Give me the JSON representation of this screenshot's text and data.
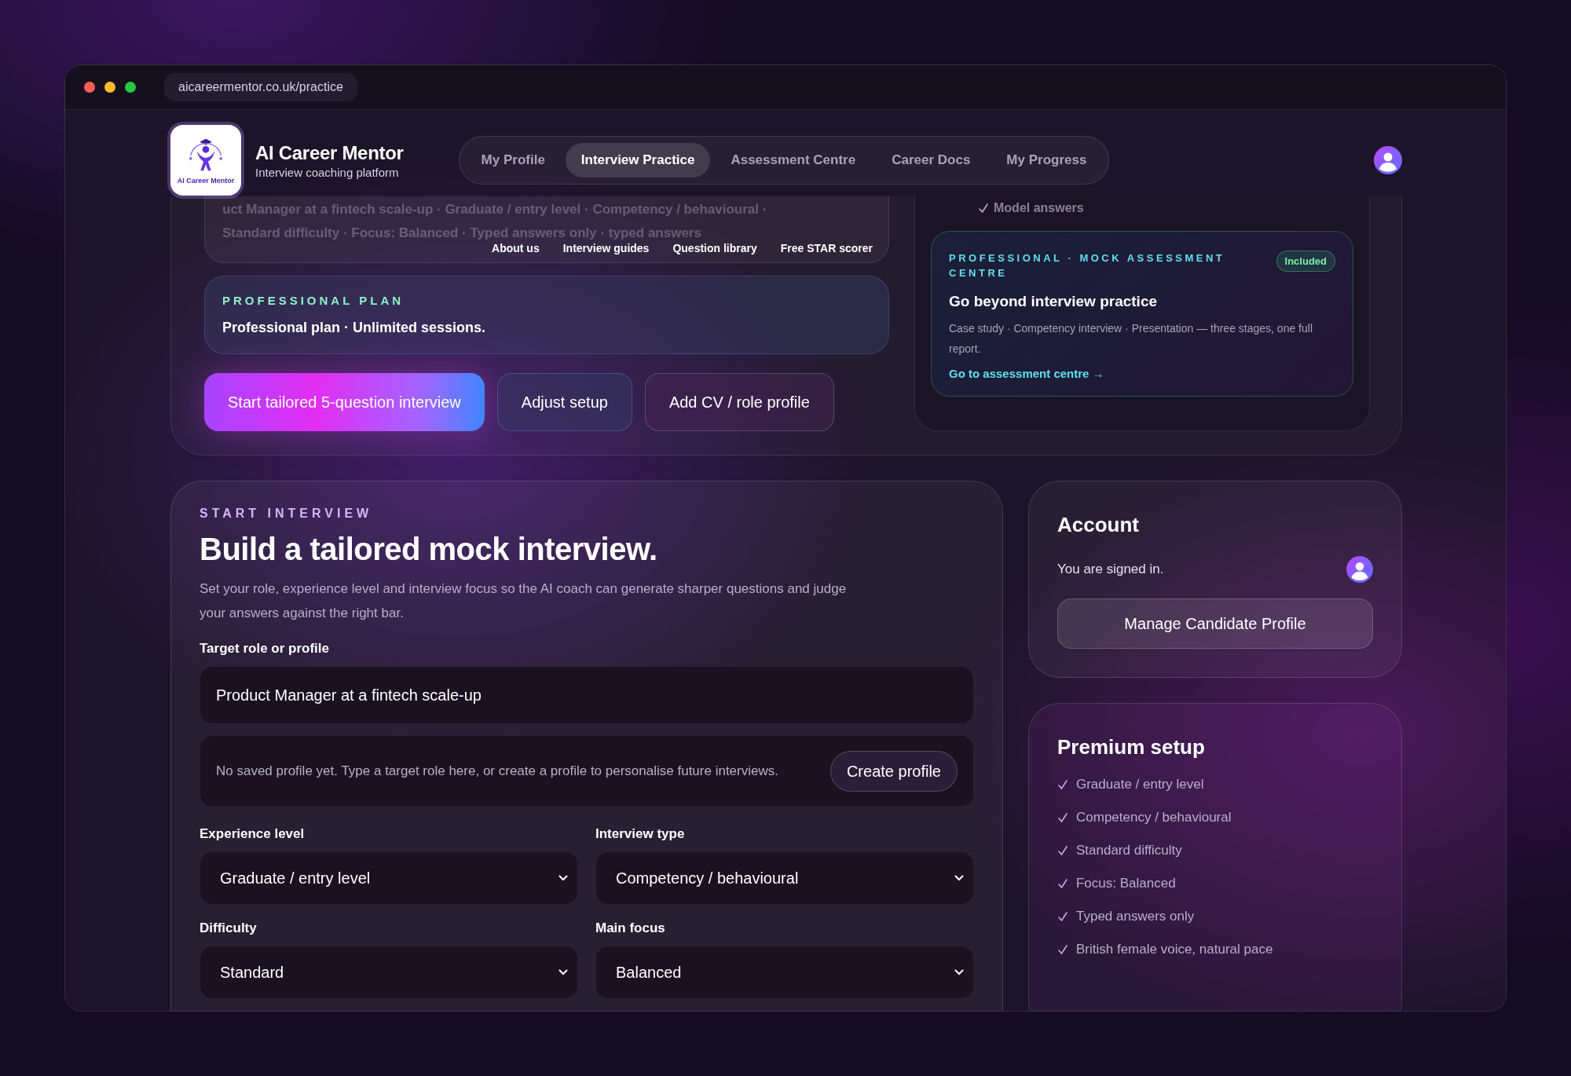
{
  "browser": {
    "url": "aicareermentor.co.uk/practice"
  },
  "brand": {
    "logo_text": "AI Career Mentor",
    "name": "AI Career Mentor",
    "tagline": "Interview coaching platform"
  },
  "nav": [
    {
      "label": "My Profile",
      "selected": false
    },
    {
      "label": "Interview Practice",
      "selected": true
    },
    {
      "label": "Assessment Centre",
      "selected": false
    },
    {
      "label": "Career Docs",
      "selected": false
    },
    {
      "label": "My Progress",
      "selected": false
    }
  ],
  "summary": {
    "lines": [
      "uct Manager at a fintech scale-up · Graduate / entry level · Competency / behavioural ·",
      "Standard difficulty · Focus: Balanced · Typed answers only · typed answers"
    ]
  },
  "secondary_links": [
    "About us",
    "Interview guides",
    "Question library",
    "Free STAR scorer"
  ],
  "plan": {
    "eyebrow": "PROFESSIONAL PLAN",
    "text": "Professional plan · Unlimited sessions."
  },
  "actions": [
    {
      "label": "Start tailored 5-question interview",
      "kind": "primary"
    },
    {
      "label": "Adjust setup",
      "kind": "secondary"
    },
    {
      "label": "Add CV / role profile",
      "kind": "outline"
    }
  ],
  "assessment_panel": {
    "chip": "Model answers",
    "eyebrow": "PROFESSIONAL · MOCK ASSESSMENT CENTRE",
    "badge": "Included",
    "title": "Go beyond interview practice",
    "text": "Case study · Competency interview · Presentation — three stages, one full report.",
    "link": "Go to assessment centre →"
  },
  "start": {
    "eyebrow": "START INTERVIEW",
    "title": "Build a tailored mock interview.",
    "description": "Set your role, experience level and interview focus so the AI coach can generate sharper questions and judge your answers against the right bar.",
    "target": {
      "label": "Target role or profile",
      "value": "Product Manager at a fintech scale-up"
    },
    "notice": {
      "text": "No saved profile yet. Type a target role here, or create a profile to personalise future interviews.",
      "button": "Create profile"
    },
    "selects": [
      {
        "label": "Experience level",
        "value": "Graduate / entry level"
      },
      {
        "label": "Interview type",
        "value": "Competency / behavioural"
      },
      {
        "label": "Difficulty",
        "value": "Standard"
      },
      {
        "label": "Main focus",
        "value": "Balanced"
      }
    ]
  },
  "account": {
    "title": "Account",
    "status": "You are signed in.",
    "button": "Manage Candidate Profile"
  },
  "premium": {
    "title": "Premium setup",
    "items": [
      "Graduate / entry level",
      "Competency / behavioural",
      "Standard difficulty",
      "Focus: Balanced",
      "Typed answers only",
      "British female voice, natural pace"
    ]
  }
}
